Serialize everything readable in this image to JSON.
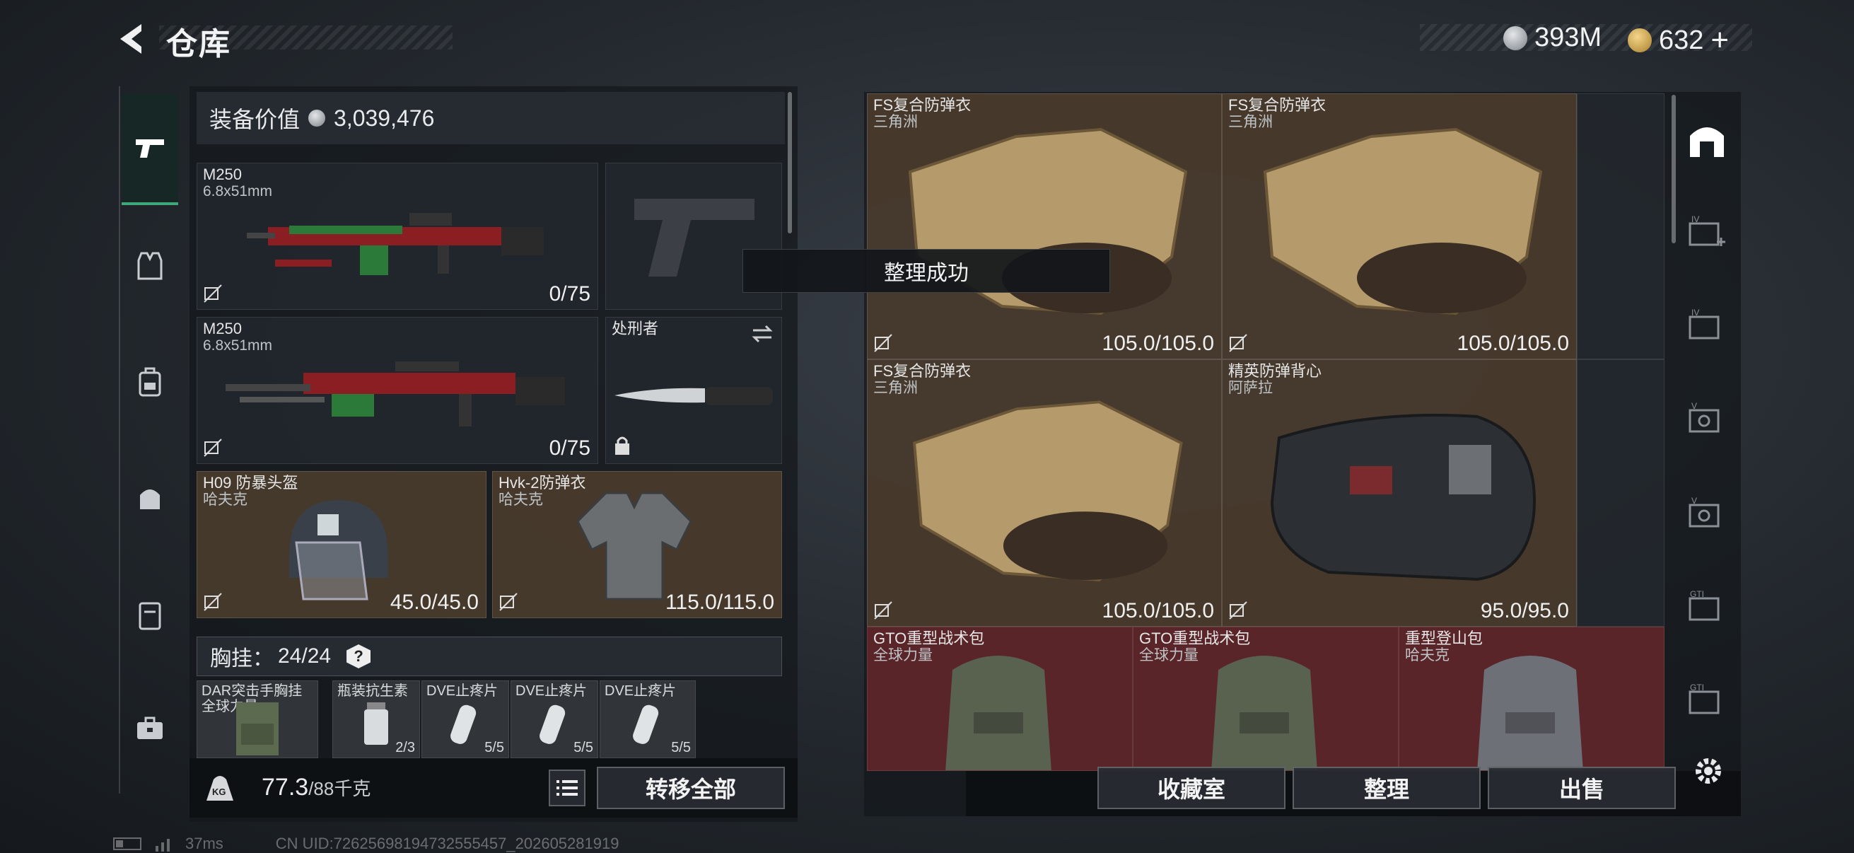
{
  "header": {
    "title": "仓库",
    "currency1": "393M",
    "currency2": "632",
    "add_label": "+"
  },
  "left_panel": {
    "equipment_value_label": "装备价值",
    "equipment_value": "3,039,476",
    "weapon1": {
      "name": "M250",
      "caliber": "6.8x51mm",
      "ammo": "0/75"
    },
    "weapon2": {
      "name": "M250",
      "caliber": "6.8x51mm",
      "ammo": "0/75"
    },
    "melee": {
      "name": "处刑者"
    },
    "helmet": {
      "name": "H09 防暴头盔",
      "brand": "哈夫克",
      "durability": "45.0/45.0"
    },
    "armor": {
      "name": "Hvk-2防弹衣",
      "brand": "哈夫克",
      "durability": "115.0/115.0"
    },
    "chest_rig": {
      "label": "胸挂：",
      "count": "24/24",
      "help": "?"
    },
    "rig_items": [
      {
        "name": "DAR突击手胸挂",
        "brand": "全球力量",
        "count": ""
      },
      {
        "name": "瓶装抗生素",
        "count": "2/3"
      },
      {
        "name": "DVE止疼片",
        "count": "5/5"
      },
      {
        "name": "DVE止疼片",
        "count": "5/5"
      },
      {
        "name": "DVE止疼片",
        "count": "5/5"
      }
    ],
    "weight_value": "77.3",
    "weight_max": "/88千克",
    "kg_label": "KG",
    "transfer_all": "转移全部"
  },
  "toast": "整理成功",
  "storage_items": [
    {
      "name": "FS复合防弹衣",
      "brand": "三角洲",
      "durability": "105.0/105.0"
    },
    {
      "name": "FS复合防弹衣",
      "brand": "三角洲",
      "durability": "105.0/105.0"
    },
    {
      "name": "FS复合防弹衣",
      "brand": "三角洲",
      "durability": "105.0/105.0"
    },
    {
      "name": "精英防弹背心",
      "brand": "阿萨拉",
      "durability": "95.0/95.0"
    },
    {
      "name": "GTO重型战术包",
      "brand": "全球力量"
    },
    {
      "name": "GTO重型战术包",
      "brand": "全球力量"
    },
    {
      "name": "重型登山包",
      "brand": "哈夫克"
    }
  ],
  "bottom_buttons": {
    "collection": "收藏室",
    "sort": "整理",
    "sell": "出售"
  },
  "status_bar": {
    "ping": "37ms",
    "uid": "CN UID:7262569819473255545​7_202605281919"
  },
  "colors": {
    "brown_cell": "#4a3c2e",
    "red_cell": "#60262a",
    "accent_green": "#3fa87a"
  }
}
